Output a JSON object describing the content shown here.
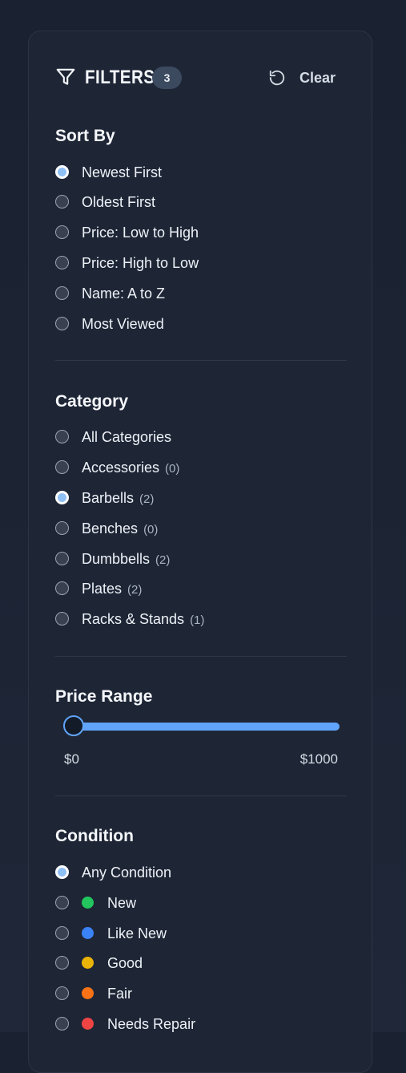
{
  "header": {
    "title": "FILTERS",
    "badge_count": "3",
    "clear_label": "Clear"
  },
  "sort": {
    "title": "Sort By",
    "options": [
      {
        "label": "Newest First",
        "checked": true
      },
      {
        "label": "Oldest First",
        "checked": false
      },
      {
        "label": "Price: Low to High",
        "checked": false
      },
      {
        "label": "Price: High to Low",
        "checked": false
      },
      {
        "label": "Name: A to Z",
        "checked": false
      },
      {
        "label": "Most Viewed",
        "checked": false
      }
    ]
  },
  "category": {
    "title": "Category",
    "options": [
      {
        "label": "All Categories",
        "count": "",
        "checked": false
      },
      {
        "label": "Accessories",
        "count": "(0)",
        "checked": false
      },
      {
        "label": "Barbells",
        "count": "(2)",
        "checked": true
      },
      {
        "label": "Benches",
        "count": "(0)",
        "checked": false
      },
      {
        "label": "Dumbbells",
        "count": "(2)",
        "checked": false
      },
      {
        "label": "Plates",
        "count": "(2)",
        "checked": false
      },
      {
        "label": "Racks & Stands",
        "count": "(1)",
        "checked": false
      }
    ]
  },
  "price": {
    "title": "Price Range",
    "min_label": "$0",
    "max_label": "$1000",
    "current_min": 0,
    "current_max": 1000
  },
  "condition": {
    "title": "Condition",
    "options": [
      {
        "label": "Any Condition",
        "color": "",
        "checked": true
      },
      {
        "label": "New",
        "color": "#22c55e",
        "checked": false
      },
      {
        "label": "Like New",
        "color": "#3b82f6",
        "checked": false
      },
      {
        "label": "Good",
        "color": "#eab308",
        "checked": false
      },
      {
        "label": "Fair",
        "color": "#f97316",
        "checked": false
      },
      {
        "label": "Needs Repair",
        "color": "#ef4444",
        "checked": false
      }
    ]
  },
  "colors": {
    "accent": "#60a5fa",
    "panel_bg": "#1e2636",
    "page_bg": "#1a2130"
  }
}
